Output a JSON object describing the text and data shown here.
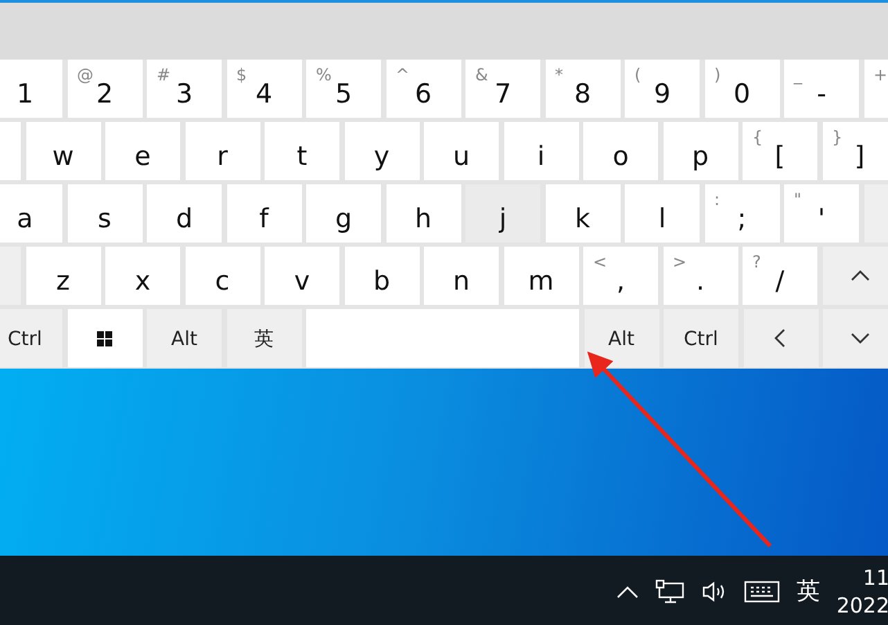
{
  "keyboard": {
    "rows": [
      [
        {
          "kind": "char",
          "label": "1",
          "pressed": false
        },
        {
          "kind": "char",
          "label": "2",
          "shift": "@",
          "pressed": false
        },
        {
          "kind": "char",
          "label": "3",
          "shift": "#",
          "pressed": false
        },
        {
          "kind": "char",
          "label": "4",
          "shift": "$",
          "pressed": false
        },
        {
          "kind": "char",
          "label": "5",
          "shift": "%",
          "pressed": false
        },
        {
          "kind": "char",
          "label": "6",
          "shift": "^",
          "pressed": false
        },
        {
          "kind": "char",
          "label": "7",
          "shift": "&",
          "pressed": false
        },
        {
          "kind": "char",
          "label": "8",
          "shift": "*",
          "pressed": false
        },
        {
          "kind": "char",
          "label": "9",
          "shift": "(",
          "pressed": false
        },
        {
          "kind": "char",
          "label": "0",
          "shift": ")",
          "pressed": false
        },
        {
          "kind": "char",
          "label": "-",
          "shift": "_",
          "pressed": false
        },
        {
          "kind": "char",
          "shift": "+",
          "pressed": false
        }
      ],
      [
        {
          "kind": "char",
          "pressed": false
        },
        {
          "kind": "char",
          "label": "w",
          "pressed": false
        },
        {
          "kind": "char",
          "label": "e",
          "pressed": false
        },
        {
          "kind": "char",
          "label": "r",
          "pressed": false
        },
        {
          "kind": "char",
          "label": "t",
          "pressed": false
        },
        {
          "kind": "char",
          "label": "y",
          "pressed": false
        },
        {
          "kind": "char",
          "label": "u",
          "pressed": false
        },
        {
          "kind": "char",
          "label": "i",
          "pressed": false
        },
        {
          "kind": "char",
          "label": "o",
          "pressed": false
        },
        {
          "kind": "char",
          "label": "p",
          "pressed": false
        },
        {
          "kind": "char",
          "label": "[",
          "shift": "{",
          "pressed": false
        },
        {
          "kind": "char",
          "label": "]",
          "shift": "}",
          "pressed": false
        }
      ],
      [
        {
          "kind": "char",
          "label": "a",
          "pressed": false
        },
        {
          "kind": "char",
          "label": "s",
          "pressed": false
        },
        {
          "kind": "char",
          "label": "d",
          "pressed": false
        },
        {
          "kind": "char",
          "label": "f",
          "pressed": false
        },
        {
          "kind": "char",
          "label": "g",
          "pressed": false
        },
        {
          "kind": "char",
          "label": "h",
          "pressed": false
        },
        {
          "kind": "char",
          "label": "j",
          "pressed": true
        },
        {
          "kind": "char",
          "label": "k",
          "pressed": false
        },
        {
          "kind": "char",
          "label": "l",
          "pressed": false
        },
        {
          "kind": "char",
          "label": ";",
          "shift": ":",
          "pressed": false
        },
        {
          "kind": "char",
          "label": "'",
          "shift": "\"",
          "pressed": false
        },
        {
          "kind": "function",
          "pressed": false
        }
      ],
      [
        {
          "kind": "function",
          "pressed": false
        },
        {
          "kind": "char",
          "label": "z",
          "pressed": false
        },
        {
          "kind": "char",
          "label": "x",
          "pressed": false
        },
        {
          "kind": "char",
          "label": "c",
          "pressed": false
        },
        {
          "kind": "char",
          "label": "v",
          "pressed": false
        },
        {
          "kind": "char",
          "label": "b",
          "pressed": false
        },
        {
          "kind": "char",
          "label": "n",
          "pressed": false
        },
        {
          "kind": "char",
          "label": "m",
          "pressed": false
        },
        {
          "kind": "char",
          "label": ",",
          "shift": "<",
          "pressed": false
        },
        {
          "kind": "char",
          "label": ".",
          "shift": ">",
          "pressed": false
        },
        {
          "kind": "char",
          "label": "/",
          "shift": "?",
          "pressed": false
        },
        {
          "kind": "up_arrow",
          "pressed": false
        }
      ],
      [
        {
          "kind": "function",
          "label": "Ctrl",
          "pressed": false
        },
        {
          "kind": "windows",
          "pressed": false
        },
        {
          "kind": "function",
          "label": "Alt",
          "pressed": false
        },
        {
          "kind": "function",
          "label": "英",
          "pressed": false
        },
        {
          "kind": "space",
          "pressed": false
        },
        {
          "kind": "function",
          "label": "Alt",
          "pressed": false
        },
        {
          "kind": "function",
          "label": "Ctrl",
          "pressed": false
        },
        {
          "kind": "left_arrow",
          "pressed": false
        },
        {
          "kind": "down_arrow",
          "pressed": false
        }
      ]
    ]
  },
  "taskbar": {
    "input_indicator": "英",
    "clock": {
      "time": "11",
      "date": "2022"
    }
  }
}
